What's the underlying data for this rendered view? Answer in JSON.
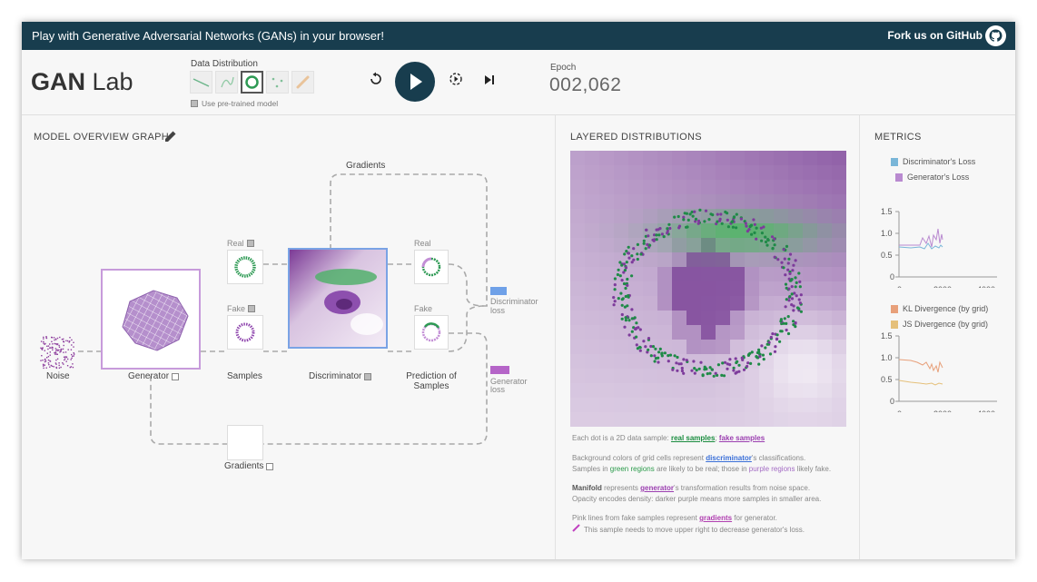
{
  "header": {
    "tagline": "Play with Generative Adversarial Networks (GANs) in your browser!",
    "fork_label": "Fork us on GitHub"
  },
  "controls": {
    "logo_bold": "GAN",
    "logo_light": " Lab",
    "data_distribution_label": "Data Distribution",
    "pretrained_label": "Use pre-trained model",
    "epoch_label": "Epoch",
    "epoch_value": "002,062"
  },
  "overview": {
    "title": "MODEL OVERVIEW GRAPH",
    "gradients_top": "Gradients",
    "noise": "Noise",
    "generator": "Generator",
    "real": "Real",
    "fake": "Fake",
    "samples": "Samples",
    "discriminator": "Discriminator",
    "pred_real": "Real",
    "pred_fake": "Fake",
    "prediction_line1": "Prediction of",
    "prediction_line2": "Samples",
    "disc_loss_line1": "Discriminator",
    "disc_loss_line2": "loss",
    "gen_loss_line1": "Generator",
    "gen_loss_line2": "loss",
    "gradients_bottom": "Gradients"
  },
  "layered": {
    "title": "LAYERED DISTRIBUTIONS",
    "d1_prefix": "Each dot is a 2D data sample: ",
    "d1_real": "real samples",
    "d1_sep": "; ",
    "d1_fake": "fake samples",
    "d2_prefix": "Background colors of grid cells represent ",
    "d2_disc": "discriminator",
    "d2_suffix": "'s classifications.",
    "d3_a": "Samples in ",
    "d3_green": "green regions",
    "d3_b": " are likely to be real; those in ",
    "d3_purple": "purple regions",
    "d3_c": " likely fake.",
    "d4_bold": "Manifold",
    "d4_a": " represents ",
    "d4_gen": "generator",
    "d4_b": "'s transformation results from noise space.",
    "d5": "Opacity encodes density: darker purple means more samples in smaller area.",
    "d6_a": "Pink lines from fake samples represent ",
    "d6_grad": "gradients",
    "d6_b": " for generator.",
    "d7": "This sample needs to move upper right to decrease generator's loss."
  },
  "metrics": {
    "title": "METRICS",
    "chart1_legend": [
      "Discriminator's Loss",
      "Generator's Loss"
    ],
    "chart2_legend": [
      "KL Divergence (by grid)",
      "JS Divergence (by grid)"
    ],
    "y_ticks": [
      "1.5",
      "1.0",
      "0.5",
      "0"
    ],
    "x_ticks": [
      "0",
      "2000",
      "4000"
    ]
  },
  "colors": {
    "header_bg": "#183d4e",
    "real_green": "#2e9a54",
    "fake_purple": "#9b59b6",
    "disc_loss": "#6fa1e8",
    "gen_loss": "#b565c8",
    "kl": "#e8a07a",
    "js": "#e5c07a"
  }
}
